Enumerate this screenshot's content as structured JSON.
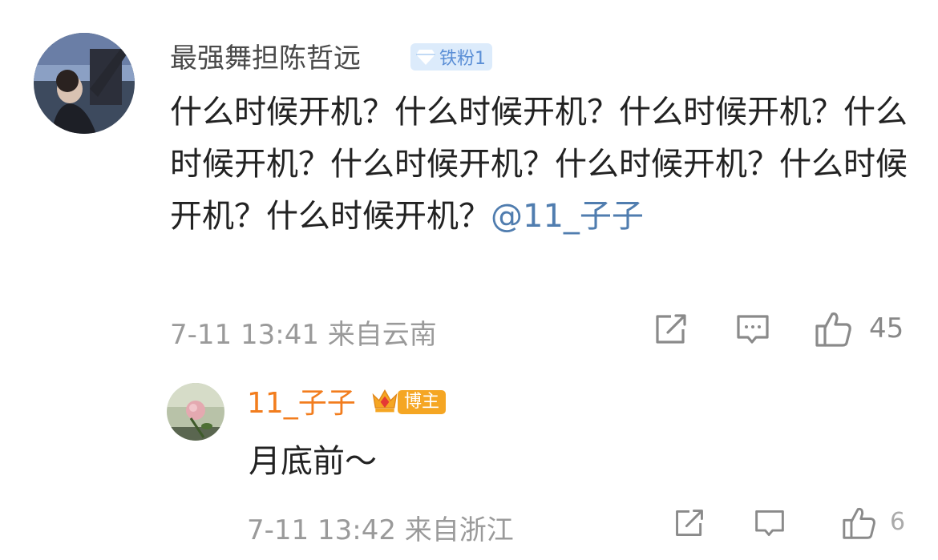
{
  "comment1": {
    "username": "最强舞担陈哲远",
    "badge": "铁粉1",
    "text": "什么时候开机？什么时候开机？什么时候开机？什么时候开机？什么时候开机？什么时候开机？什么时候开机？什么时候开机？",
    "mention": "@11_子子",
    "time": "7-11 13:41",
    "location": "来自云南",
    "likes": "45",
    "icons": {
      "repost": "repost-icon",
      "comment": "comment-icon",
      "like": "thumbs-up-icon"
    }
  },
  "comment2": {
    "username": "11_子子",
    "badge": "博主",
    "text": "月底前～",
    "time": "7-11 13:42",
    "location": "来自浙江",
    "likes": "6",
    "icons": {
      "repost": "repost-icon",
      "comment": "comment-icon",
      "like": "thumbs-up-icon"
    }
  },
  "colors": {
    "mention": "#507daf",
    "reply_username": "#f27d1e",
    "fan_badge_bg": "#dcebfb",
    "blogger_badge_bg": "#f5a623",
    "meta": "#9a9a9a"
  }
}
